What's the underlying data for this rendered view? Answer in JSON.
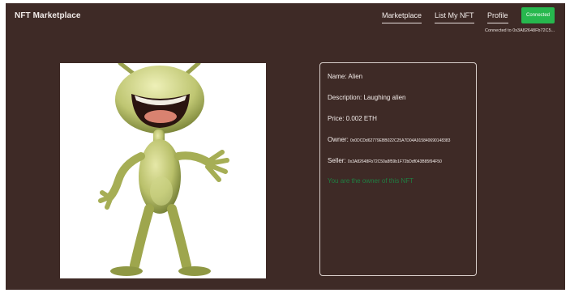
{
  "header": {
    "brand": "NFT Marketplace",
    "nav": {
      "marketplace": "Marketplace",
      "list_nft": "List My NFT",
      "profile": "Profile"
    },
    "connect_button": "Connected",
    "connection_status": "Connected to 0x3A82648Fb72C5..."
  },
  "nft": {
    "image_icon": "alien-character-image",
    "name_row": "Name: Alien",
    "description_row": "Description: Laughing alien",
    "price_row": "Price: 0.002 ETH",
    "owner_label": "Owner:",
    "owner_address": "0x0DCDd62779EBB022C25A7D04A915840690148383",
    "seller_label": "Seller:",
    "seller_address": "0x3A82648Fb72C50a8f59b1F72bDdf043B85f94F50",
    "owner_note": "You are the owner of this NFT"
  },
  "colors": {
    "background": "#3e2a26",
    "connect_button": "#27b84e",
    "owner_note": "#1f7f42"
  }
}
